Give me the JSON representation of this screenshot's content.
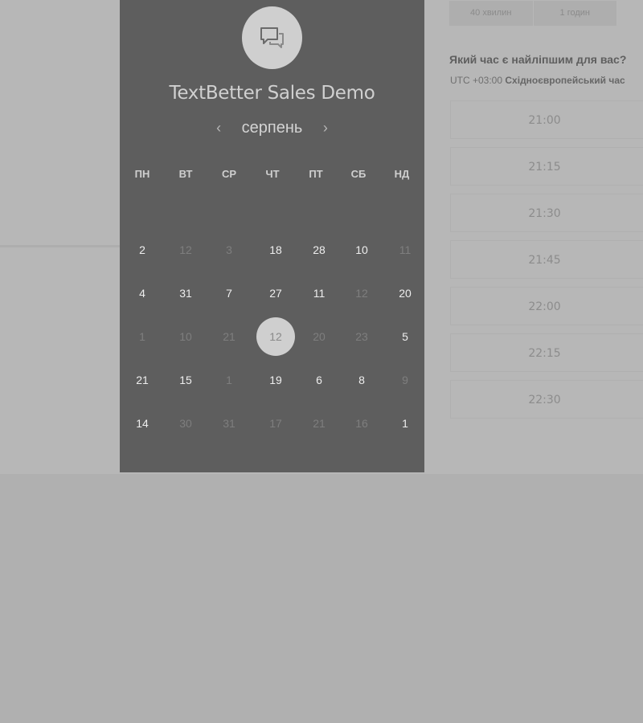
{
  "panel": {
    "icon": "chat-bubbles-icon",
    "title": "TextBetter Sales Demo",
    "month": "серпень",
    "prev_arrow": "‹",
    "next_arrow": "›",
    "weekdays": [
      "ПН",
      "ВТ",
      "СР",
      "ЧТ",
      "ПТ",
      "СБ",
      "НД"
    ],
    "weeks": [
      [
        {
          "d": "2",
          "s": "on"
        },
        {
          "d": "12",
          "s": "off"
        },
        {
          "d": "3",
          "s": "off"
        },
        {
          "d": "18",
          "s": "on"
        },
        {
          "d": "28",
          "s": "on"
        },
        {
          "d": "10",
          "s": "on"
        },
        {
          "d": "11",
          "s": "off"
        }
      ],
      [
        {
          "d": "4",
          "s": "on"
        },
        {
          "d": "31",
          "s": "on"
        },
        {
          "d": "7",
          "s": "on"
        },
        {
          "d": "27",
          "s": "on"
        },
        {
          "d": "11",
          "s": "on"
        },
        {
          "d": "12",
          "s": "off"
        },
        {
          "d": "20",
          "s": "on"
        }
      ],
      [
        {
          "d": "1",
          "s": "off"
        },
        {
          "d": "10",
          "s": "off"
        },
        {
          "d": "21",
          "s": "off"
        },
        {
          "d": "12",
          "s": "sel"
        },
        {
          "d": "20",
          "s": "off"
        },
        {
          "d": "23",
          "s": "off"
        },
        {
          "d": "5",
          "s": "on"
        }
      ],
      [
        {
          "d": "21",
          "s": "on"
        },
        {
          "d": "15",
          "s": "on"
        },
        {
          "d": "1",
          "s": "off"
        },
        {
          "d": "19",
          "s": "on"
        },
        {
          "d": "6",
          "s": "on"
        },
        {
          "d": "8",
          "s": "on"
        },
        {
          "d": "9",
          "s": "off"
        }
      ],
      [
        {
          "d": "14",
          "s": "on"
        },
        {
          "d": "30",
          "s": "off"
        },
        {
          "d": "31",
          "s": "off"
        },
        {
          "d": "17",
          "s": "off"
        },
        {
          "d": "21",
          "s": "off"
        },
        {
          "d": "16",
          "s": "off"
        },
        {
          "d": "1",
          "s": "on"
        }
      ]
    ]
  },
  "durations": [
    "40 хвилин",
    "1 годин"
  ],
  "question": "Який час є найліпшим для вас?",
  "timezone": {
    "offset": "UTC +03:00",
    "name": "Східноєвропейський час"
  },
  "slots": [
    "21:00",
    "21:15",
    "21:30",
    "21:45",
    "22:00",
    "22:15",
    "22:30"
  ],
  "colors": {
    "panel_bg": "#5e5e5e",
    "page_bg": "#b7b7b7",
    "selected_day": "#cfcfcf"
  }
}
